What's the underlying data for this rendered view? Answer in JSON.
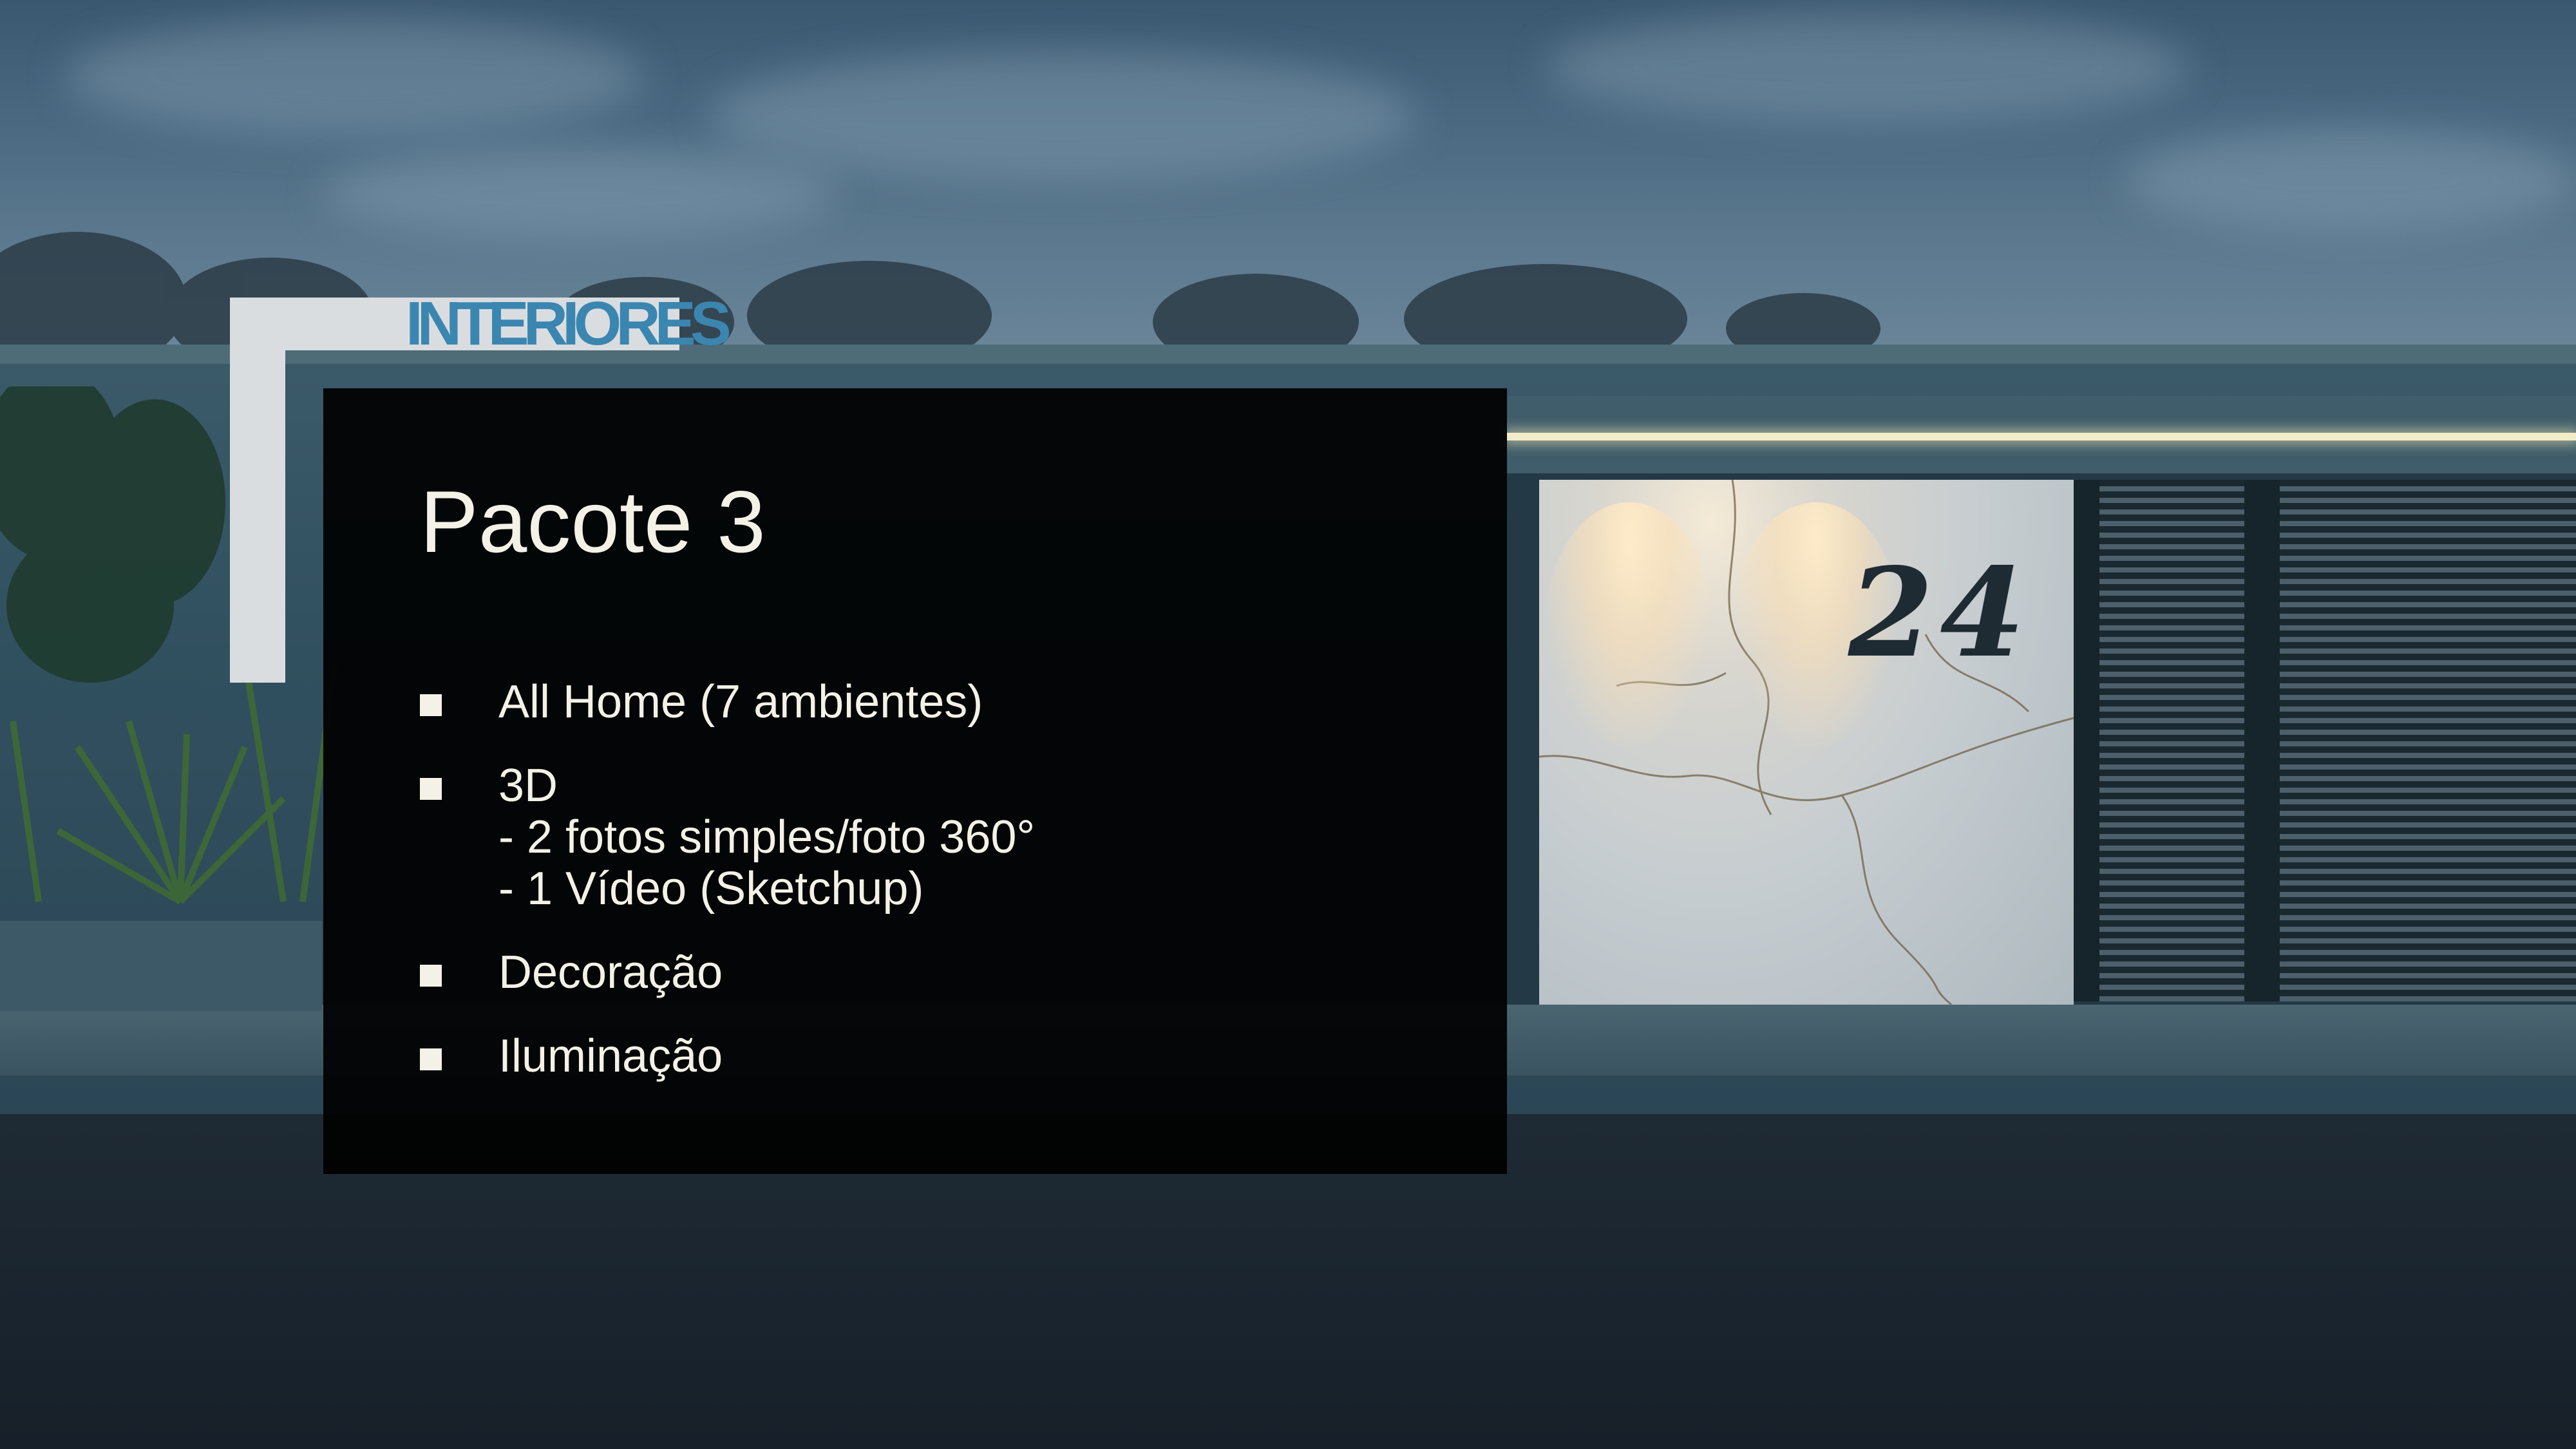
{
  "slide": {
    "section_tag": "INTERIORES",
    "title": "Pacote 3",
    "items": [
      {
        "lines": [
          "All Home (7 ambientes)"
        ]
      },
      {
        "lines": [
          "3D",
          "- 2 fotos simples/foto 360°",
          "- 1 Vídeo (Sketchup)"
        ]
      },
      {
        "lines": [
          "Decoração"
        ]
      },
      {
        "lines": [
          "Iluminação"
        ]
      }
    ]
  },
  "background": {
    "house_number": "24"
  },
  "colors": {
    "section_tag": "#3b86b0",
    "accent_frame": "#d9dde0",
    "panel": "#000000",
    "text": "#f4f1e6"
  }
}
